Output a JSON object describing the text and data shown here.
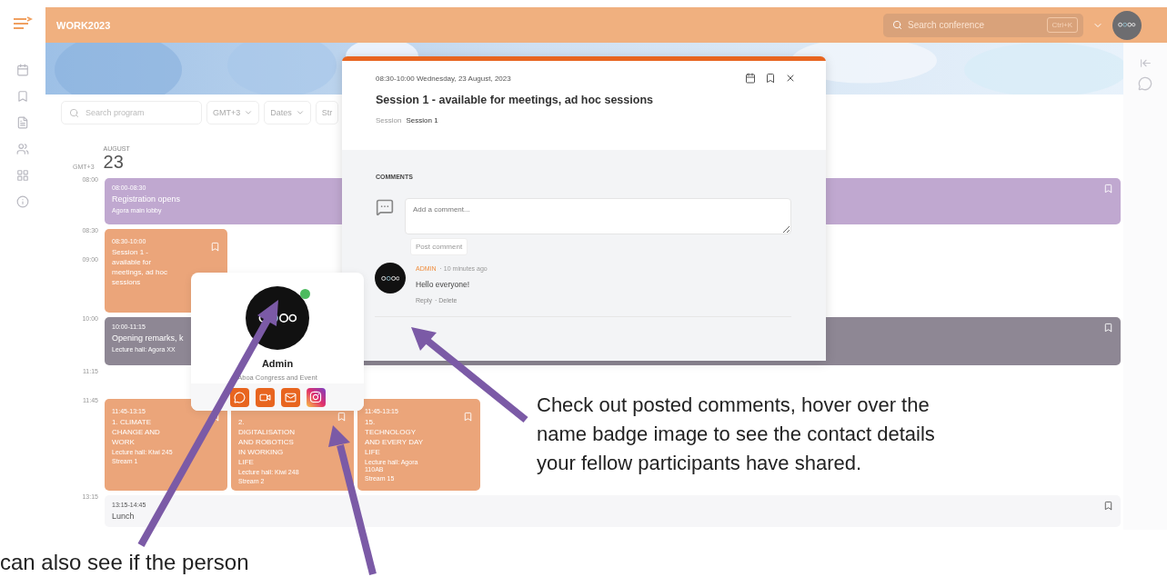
{
  "app": {
    "title": "WORK2023",
    "search_placeholder": "Search conference",
    "shortcut": "Ctrl+K"
  },
  "filters": {
    "search_placeholder": "Search program",
    "timezone": "GMT+3",
    "dates": "Dates",
    "stream": "Str"
  },
  "day": {
    "month": "AUGUST",
    "date": "23",
    "timezone": "GMT+3"
  },
  "slots": [
    {
      "times": [
        "08:00"
      ],
      "events": [
        {
          "kind": "banner",
          "color": "#c0a8d0",
          "time": "08:00-08:30",
          "title": "Registration opens",
          "location": "Agora main lobby"
        }
      ]
    },
    {
      "times": [
        "08:30",
        "09:00"
      ],
      "events": [
        {
          "kind": "card",
          "color": "#eba57a",
          "time": "08:30-10:00",
          "title": "Session 1 - available for meetings, ad hoc sessions"
        }
      ]
    },
    {
      "times": [
        "10:00"
      ],
      "events": [
        {
          "kind": "banner",
          "color": "#8e8794",
          "time": "10:00-11:15",
          "title": "Opening remarks, k",
          "location": "Lecture hall: Agora XX"
        }
      ]
    },
    {
      "times": [
        "11:15"
      ]
    },
    {
      "times": [
        "11:45"
      ],
      "events": [
        {
          "kind": "card",
          "color": "#eba57a",
          "time": "11:45-13:15",
          "title": "1. CLIMATE CHANGE AND WORK",
          "location": "Lecture hall: Kiwi 245",
          "stream": "Stream 1"
        },
        {
          "kind": "card",
          "color": "#eba57a",
          "title": "2. DIGITALISATION AND ROBOTICS IN WORKING LIFE",
          "location": "Lecture hall: Kiwi 248",
          "stream": "Stream 2"
        },
        {
          "kind": "card",
          "color": "#eba57a",
          "time": "11:45-13:15",
          "title": "15. TECHNOLOGY AND EVERY DAY LIFE",
          "location": "Lecture hall: Agora 110AB",
          "stream": "Stream 15"
        }
      ]
    },
    {
      "times": [
        "13:15"
      ],
      "events": [
        {
          "kind": "banner",
          "color": "#f6f6f8",
          "time": "13:15-14:45",
          "title": "Lunch"
        }
      ]
    }
  ],
  "session_modal": {
    "datetime": "08:30-10:00 Wednesday, 23 August, 2023",
    "title": "Session 1 - available for meetings, ad hoc sessions",
    "type_label": "Session",
    "type_value": "Session 1",
    "comments_heading": "COMMENTS",
    "comment_placeholder": "Add a comment...",
    "post_button": "Post comment",
    "comments": [
      {
        "author": "ADMIN",
        "age": "· 10 minutes ago",
        "text": "Hello everyone!",
        "actions": [
          "Reply",
          "· Delete"
        ]
      }
    ]
  },
  "profile_card": {
    "name": "Admin",
    "organization": "Aboa Congress and Event",
    "online": true,
    "contacts": [
      {
        "kind": "chat"
      },
      {
        "kind": "video"
      },
      {
        "kind": "mail"
      },
      {
        "kind": "instagram"
      }
    ]
  },
  "callout": "Check out posted comments, hover over the name badge image to see the contact details your fellow participants have shared.",
  "caption": "can also see if the person"
}
